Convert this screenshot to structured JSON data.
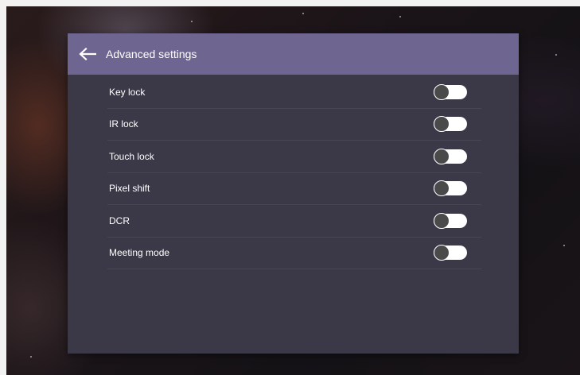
{
  "panel": {
    "title": "Advanced settings",
    "back_icon": "arrow-left-icon"
  },
  "settings": [
    {
      "label": "Key lock",
      "enabled": false
    },
    {
      "label": "IR lock",
      "enabled": false
    },
    {
      "label": "Touch lock",
      "enabled": false
    },
    {
      "label": "Pixel shift",
      "enabled": false
    },
    {
      "label": "DCR",
      "enabled": false
    },
    {
      "label": "Meeting mode",
      "enabled": false
    }
  ],
  "colors": {
    "header_bg": "#6e6690",
    "panel_bg": "#3b3848",
    "text": "#ffffff",
    "toggle_track_off": "#ffffff",
    "toggle_knob_off": "#4a4a4a"
  }
}
